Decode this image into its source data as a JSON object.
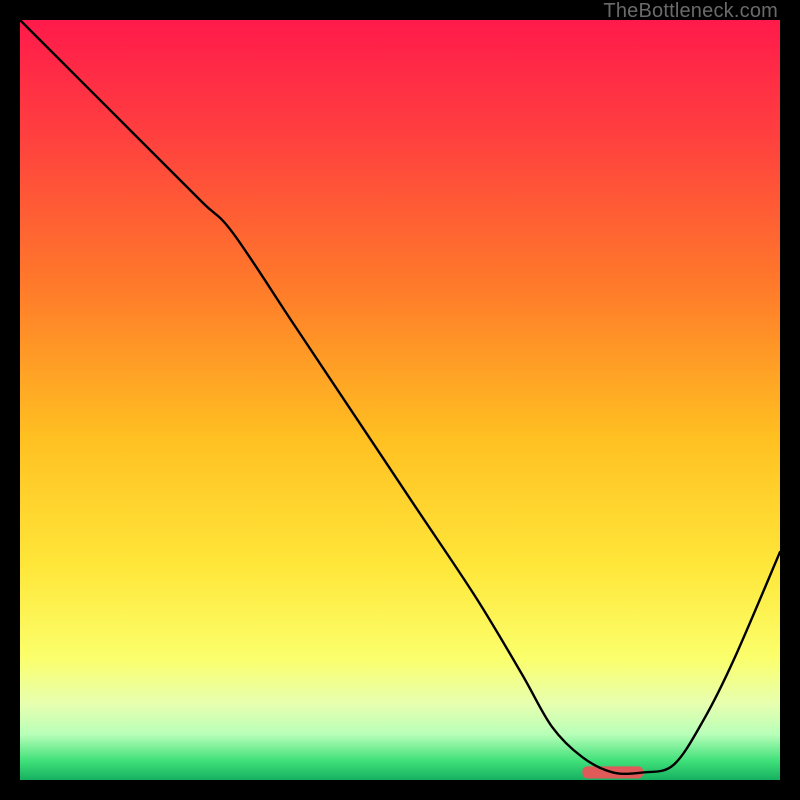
{
  "watermark": "TheBottleneck.com",
  "chart_data": {
    "type": "line",
    "title": "",
    "xlabel": "",
    "ylabel": "",
    "xlim": [
      0,
      100
    ],
    "ylim": [
      0,
      100
    ],
    "grid": false,
    "legend": false,
    "gradient_stops": [
      {
        "offset": 0.0,
        "color": "#ff1a4b"
      },
      {
        "offset": 0.15,
        "color": "#ff3f3f"
      },
      {
        "offset": 0.35,
        "color": "#ff7a2a"
      },
      {
        "offset": 0.55,
        "color": "#ffc021"
      },
      {
        "offset": 0.72,
        "color": "#ffe73a"
      },
      {
        "offset": 0.84,
        "color": "#fbff6c"
      },
      {
        "offset": 0.9,
        "color": "#e7ffb0"
      },
      {
        "offset": 0.94,
        "color": "#b8ffb8"
      },
      {
        "offset": 0.975,
        "color": "#3fe07a"
      },
      {
        "offset": 1.0,
        "color": "#16b060"
      }
    ],
    "series": [
      {
        "name": "bottleneck-curve",
        "stroke": "#000000",
        "stroke_width": 2.4,
        "x": [
          0,
          8,
          16,
          24,
          28,
          36,
          44,
          52,
          60,
          66,
          70,
          74,
          78,
          82,
          86,
          90,
          94,
          100
        ],
        "y": [
          100,
          92,
          84,
          76,
          72,
          60,
          48,
          36,
          24,
          14,
          7,
          3,
          1,
          1,
          2,
          8,
          16,
          30
        ]
      }
    ],
    "marker": {
      "name": "optimal-marker",
      "color": "#e05a5a",
      "x_start": 74,
      "x_end": 82,
      "y": 1,
      "height_pct": 1.6
    }
  }
}
